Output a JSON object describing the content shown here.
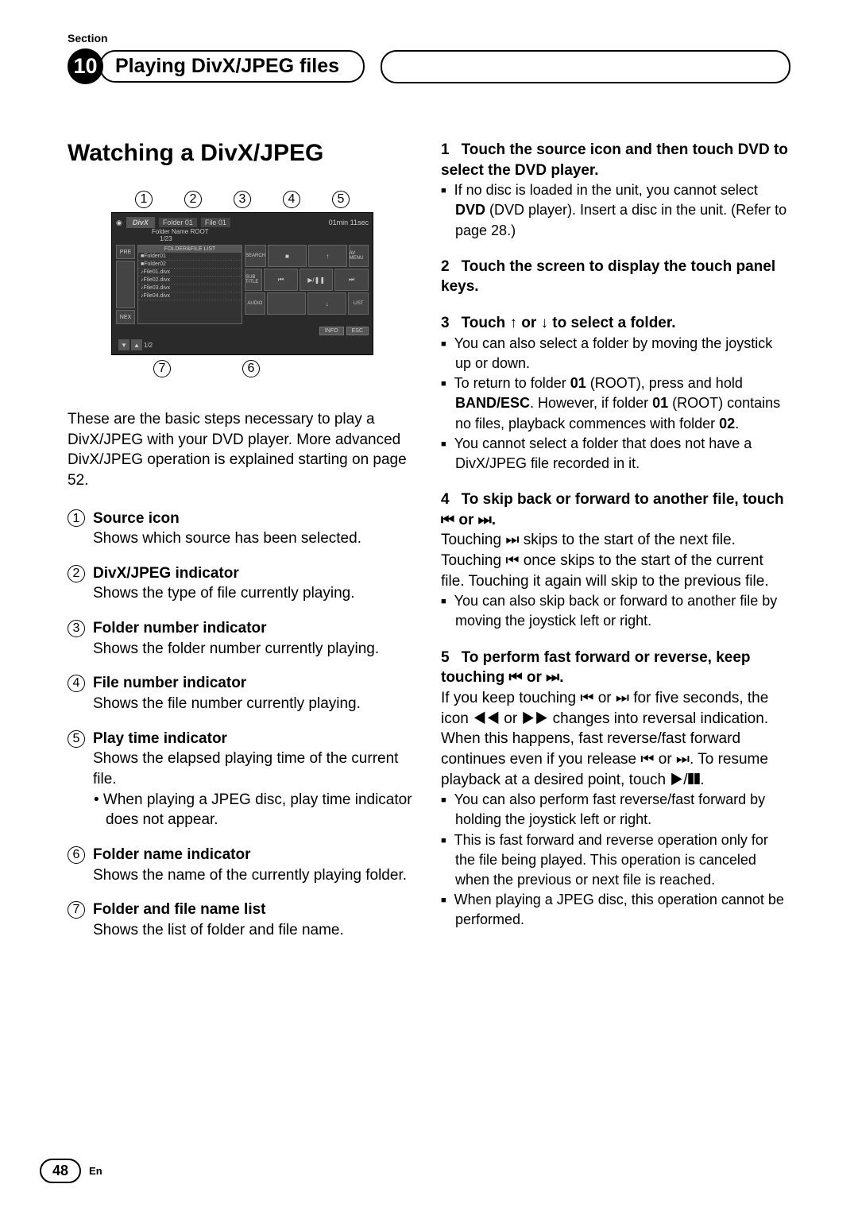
{
  "section_label": "Section",
  "section_number": "10",
  "section_title": "Playing DivX/JPEG files",
  "main_heading": "Watching a DivX/JPEG",
  "diagram": {
    "top_callouts": [
      "1",
      "2",
      "3",
      "4",
      "5"
    ],
    "bottom_callouts": [
      "7",
      "6"
    ],
    "logo": "DivX",
    "folder_label": "Folder 01",
    "file_label": "File 01",
    "time_label": "01min 11sec",
    "folder_name_row": "Folder Name ROOT",
    "count_indicator": "1/23",
    "list_header": "FOLDER&FILE LIST",
    "side_prev": "PRE",
    "side_next": "NEX",
    "list_items": [
      "■Folder01",
      "■Folder02",
      "♪File01.divx",
      "♪File02.divx",
      "♪File03.divx",
      "♪File04.divx"
    ],
    "btn_search": "SEARCH",
    "btn_stop": "■",
    "btn_up": "↑",
    "btn_avmenu": "AV MENU",
    "btn_subtitle": "SUB TITLE",
    "btn_prev": "⏮",
    "btn_play": "▶/❚❚",
    "btn_next": "⏭",
    "btn_audio": "AUDIO",
    "btn_down": "↓",
    "btn_list": "LIST",
    "btn_info": "INFO",
    "btn_esc": "ESC",
    "footer_arrows": [
      "▼",
      "▲"
    ],
    "footer_page": "1/2"
  },
  "intro_text": "These are the basic steps necessary to play a DivX/JPEG with your DVD player. More advanced DivX/JPEG operation is explained starting on page 52.",
  "items": [
    {
      "num": "1",
      "title": "Source icon",
      "desc": "Shows which source has been selected."
    },
    {
      "num": "2",
      "title": "DivX/JPEG indicator",
      "desc": "Shows the type of file currently playing."
    },
    {
      "num": "3",
      "title": "Folder number indicator",
      "desc": "Shows the folder number currently playing."
    },
    {
      "num": "4",
      "title": "File number indicator",
      "desc": "Shows the file number currently playing."
    },
    {
      "num": "5",
      "title": "Play time indicator",
      "desc": "Shows the elapsed playing time of the current file.",
      "sub": "• When playing a JPEG disc, play time indicator does not appear."
    },
    {
      "num": "6",
      "title": "Folder name indicator",
      "desc": "Shows the name of the currently playing folder."
    },
    {
      "num": "7",
      "title": "Folder and file name list",
      "desc": "Shows the list of folder and file name."
    }
  ],
  "steps": {
    "s1": {
      "num": "1",
      "title_a": "Touch the source icon and then touch DVD to select the DVD player.",
      "note1_a": "If no disc is loaded in the unit, you cannot select ",
      "note1_b": "DVD",
      "note1_c": " (DVD player). Insert a disc in the unit. (Refer to page 28.)"
    },
    "s2": {
      "num": "2",
      "title": "Touch the screen to display the touch panel keys."
    },
    "s3": {
      "num": "3",
      "title": "Touch ↑ or ↓ to select a folder.",
      "note1": "You can also select a folder by moving the joystick up or down.",
      "note2_a": "To return to folder ",
      "note2_b": "01",
      "note2_c": " (ROOT), press and hold ",
      "note2_d": "BAND/ESC",
      "note2_e": ". However, if folder ",
      "note2_f": "01",
      "note2_g": " (ROOT) contains no files, playback commences with folder ",
      "note2_h": "02",
      "note2_i": ".",
      "note3": "You cannot select a folder that does not have a DivX/JPEG file recorded in it."
    },
    "s4": {
      "num": "4",
      "title": "To skip back or forward to another file, touch ⏮ or ⏭.",
      "body": "Touching ⏭ skips to the start of the next file. Touching ⏮ once skips to the start of the current file. Touching it again will skip to the previous file.",
      "note1": "You can also skip back or forward to another file by moving the joystick left or right."
    },
    "s5": {
      "num": "5",
      "title": "To perform fast forward or reverse, keep touching ⏮ or ⏭.",
      "body": "If you keep touching ⏮ or ⏭ for five seconds, the icon ◀◀ or ▶▶ changes into reversal indication. When this happens, fast reverse/fast forward continues even if you release ⏮ or ⏭. To resume playback at a desired point, touch ▶/❚❚.",
      "note1": "You can also perform fast reverse/fast forward by holding the joystick left or right.",
      "note2": "This is fast forward and reverse operation only for the file being played. This operation is canceled when the previous or next file is reached.",
      "note3": "When playing a JPEG disc, this operation cannot be performed."
    }
  },
  "page_number": "48",
  "lang": "En"
}
